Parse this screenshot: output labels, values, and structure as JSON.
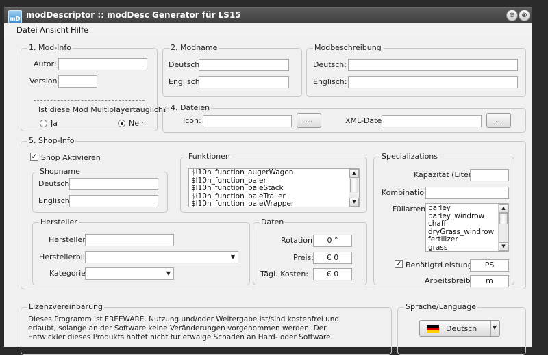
{
  "window": {
    "title": "modDescriptor :: modDesc Generator für LS15",
    "icon_text": "mD",
    "minimize_glyph": "⊖",
    "close_glyph": "⊗"
  },
  "menu": [
    "Datei",
    "Ansicht",
    "Hilfe"
  ],
  "modinfo": {
    "legend": "1. Mod-Info",
    "autor_label": "Autor:",
    "autor_value": "",
    "version_label": "Version:",
    "version_value": "",
    "multiplayer_question": "Ist diese Mod Multiplayertauglich?",
    "ja_label": "Ja",
    "nein_label": "Nein",
    "selected": "Nein"
  },
  "modname": {
    "legend": "2. Modname",
    "deutsch_label": "Deutsch:",
    "englisch_label": "Englisch:",
    "deutsch_value": "",
    "englisch_value": ""
  },
  "modbeschreibung": {
    "legend": "Modbeschreibung",
    "deutsch_label": "Deutsch:",
    "englisch_label": "Englisch:",
    "deutsch_value": "",
    "englisch_value": ""
  },
  "dateien": {
    "legend": "4. Dateien",
    "icon_label": "Icon:",
    "xml_label": "XML-Datei:",
    "browse_label": "..."
  },
  "shopinfo": {
    "legend": "5. Shop-Info",
    "shop_aktivieren_label": "Shop Aktivieren",
    "shop_aktivieren_checked": true,
    "shopname": {
      "legend": "Shopname",
      "deutsch_label": "Deutsch:",
      "englisch_label": "Englisch:"
    },
    "funktionen": {
      "legend": "Funktionen",
      "items": [
        "$l10n_function_augerWagon",
        "$l10n_function_baler",
        "$l10n_function_baleStack",
        "$l10n_function_baleTrailer",
        "$l10n_function_baleWrapper"
      ]
    },
    "hersteller": {
      "legend": "Hersteller",
      "hersteller_label": "Hersteller:",
      "herstellerbild_label": "Herstellerbild:",
      "kategorie_label": "Kategorie:"
    },
    "daten": {
      "legend": "Daten",
      "rotation_label": "Rotation:",
      "rotation_value": "0 °",
      "preis_label": "Preis:",
      "preis_value": "€ 0",
      "kosten_label": "Tägl. Kosten:",
      "kosten_value": "€ 0"
    },
    "specializations": {
      "legend": "Specializations",
      "kapazitaet_label": "Kapazität (Liter):",
      "kombination_label": "Kombination:",
      "fuellarten_label": "Füllarten:",
      "fuellarten": [
        "barley",
        "barley_windrow",
        "chaff",
        "dryGrass_windrow",
        "fertilizer",
        "grass"
      ],
      "leistung_checked": true,
      "benoetigte_label": "Benötigte",
      "leistung_label": "Leistung:",
      "leistung_unit": "PS",
      "arbeitsbreite_label": "Arbeitsbreite:",
      "arbeitsbreite_unit": "m"
    }
  },
  "lizenz": {
    "legend": "Lizenzvereinbarung",
    "text": "Dieses Programm ist FREEWARE. Nutzung und/oder Weitergabe ist/sind kostenfrei und erlaubt, solange an der Software keine Veränderungen vorgenommen werden. Der Entwickler dieses Produkts haftet nicht für etwaige Schäden an Hard- oder Software."
  },
  "language": {
    "legend": "Sprache/Language",
    "selected": "Deutsch",
    "flag_colors": [
      "#000000",
      "#dd0000",
      "#ffce00"
    ]
  }
}
